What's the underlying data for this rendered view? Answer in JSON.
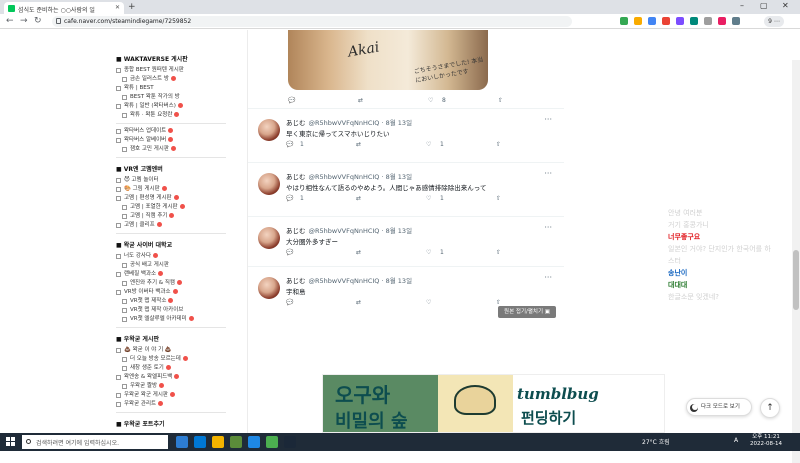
{
  "browser": {
    "tab_title": "섬식도 준비하는 ○○사람의 일",
    "url": "cafe.naver.com/steamindiegame/7259852",
    "profile": "9 ⋯"
  },
  "left_menu": {
    "sections": [
      {
        "heading": "■ WAKTAVERSE 게시판",
        "items": [
          {
            "label": "종합 BEST 원떠텐 게시판",
            "sub": false,
            "badge": false
          },
          {
            "label": "금손 일러스트 방",
            "sub": true,
            "badge": true
          },
          {
            "label": "왁튜 | BEST",
            "sub": false,
            "badge": false
          },
          {
            "label": "BEST 왁툰 작가의 방",
            "sub": true,
            "badge": false
          },
          {
            "label": "왁튜 | 일반 (왁타버스)",
            "sub": false,
            "badge": true
          },
          {
            "label": "왁튜 · 왁툰 요청란",
            "sub": true,
            "badge": true
          }
        ]
      },
      {
        "heading": "",
        "items": [
          {
            "label": "왁타버스 업데이트",
            "sub": false,
            "badge": true
          },
          {
            "label": "왁타버스 알베이버",
            "sub": false,
            "badge": true
          },
          {
            "label": "잼호 고민 게시판",
            "sub": true,
            "badge": true
          }
        ]
      },
      {
        "heading": "■ VR엔 고멤엔버",
        "items": [
          {
            "label": "😈 고멤 놀이터",
            "sub": false,
            "badge": false
          },
          {
            "label": "🎨 그림 게시판",
            "sub": false,
            "badge": true
          },
          {
            "label": "고멤 | 편성명 게시판",
            "sub": false,
            "badge": true
          },
          {
            "label": "고멤 | 포열한 게시판",
            "sub": true,
            "badge": true
          },
          {
            "label": "고멤 | 직캠 추기",
            "sub": true,
            "badge": true
          },
          {
            "label": "고멤 | 클리프",
            "sub": false,
            "badge": true
          }
        ]
      },
      {
        "heading": "■ 왁굳 사이버 대학교",
        "items": [
          {
            "label": "너도 강사다",
            "sub": false,
            "badge": true
          },
          {
            "label": "공식 배고 게시판",
            "sub": true,
            "badge": false
          },
          {
            "label": "랜베질 백과소",
            "sub": false,
            "badge": true
          },
          {
            "label": "엔진와 추기 & 직캠",
            "sub": true,
            "badge": true
          },
          {
            "label": "VR방 이버타 백과소",
            "sub": false,
            "badge": true
          },
          {
            "label": "VR챗 맵 제작소",
            "sub": true,
            "badge": true
          },
          {
            "label": "VR챗 맵 제작 아카이브",
            "sub": true,
            "badge": false
          },
          {
            "label": "VR챗 엘살루엘 아카데미",
            "sub": true,
            "badge": true
          }
        ]
      },
      {
        "heading": "■ 우왁굳 게시판",
        "items": [
          {
            "label": "💩 왁굳 이 야 기 💩",
            "sub": false,
            "badge": false
          },
          {
            "label": "더 오늘 방송 모르는데",
            "sub": true,
            "badge": true
          },
          {
            "label": "새창 생준 토기",
            "sub": true,
            "badge": true
          },
          {
            "label": "왁엔송 & 왁엘피드백",
            "sub": false,
            "badge": true
          },
          {
            "label": "우왁굳 짤방",
            "sub": true,
            "badge": true
          },
          {
            "label": "우왁굳 왁군 게시판",
            "sub": false,
            "badge": true
          },
          {
            "label": "우왁굳 관리트",
            "sub": false,
            "badge": true
          }
        ]
      },
      {
        "heading": "■ 우왁굳 포트추기",
        "items": []
      }
    ]
  },
  "tweets": [
    {
      "name": "あじむ",
      "handle": "@R5hbwVVFqNnHCIQ · 8월 13일",
      "text": "早く東京に帰ってスマホいじりたい",
      "reply": "1",
      "retweet": "",
      "like": "1"
    },
    {
      "name": "あじむ",
      "handle": "@R5hbwVVFqNnHCIQ · 8월 13일",
      "text": "やはり相性なんて語るのやめよう。人間じゃあ感情排除除出来んって",
      "reply": "1",
      "retweet": "",
      "like": "1"
    },
    {
      "name": "あじむ",
      "handle": "@R5hbwVVFqNnHCIQ · 8월 13일",
      "text": "大分圏外多すぎー",
      "reply": "",
      "retweet": "",
      "like": "1"
    },
    {
      "name": "あじむ",
      "handle": "@R5hbwVVFqNnHCIQ · 8월 13일",
      "text": "宇和島",
      "reply": "",
      "retweet": "",
      "like": ""
    }
  ],
  "first_card": {
    "signature": "Akai",
    "handwriting": "ごちそうさまでした! 本当においしかったです",
    "like": "8"
  },
  "hide_button": "원본 접기/펼치기 ▣",
  "banner": {
    "left_line1": "오구와",
    "left_line2": "비밀의 숲",
    "right_line1": "tumblbug",
    "right_line2": "펀딩하기"
  },
  "dark_mode_label": "다크 모드로 보기",
  "top_button": "↑",
  "chat": [
    {
      "text": "안녕 여러분",
      "color": "#d0d0d0"
    },
    {
      "text": "거기 홍콩가니",
      "color": "#d0d0d0"
    },
    {
      "text": "너무좋구요",
      "color": "#e0171c"
    },
    {
      "text": "일본인 거야? 단지인가 한국어를 하",
      "color": "#d0d0d0"
    },
    {
      "text": "스터",
      "color": "#d0d0d0"
    },
    {
      "text": "송난이",
      "color": "#1565c0"
    },
    {
      "text": "대대대",
      "color": "#2e7d32"
    },
    {
      "text": "한글소문 잊겠네?",
      "color": "#d0d0d0"
    }
  ],
  "taskbar": {
    "search_placeholder": "검색하려면 여기에 입력하십시오.",
    "weather": "27°C 흐림",
    "lang": "A",
    "time": "오후 11:21",
    "date": "2022-08-14"
  }
}
